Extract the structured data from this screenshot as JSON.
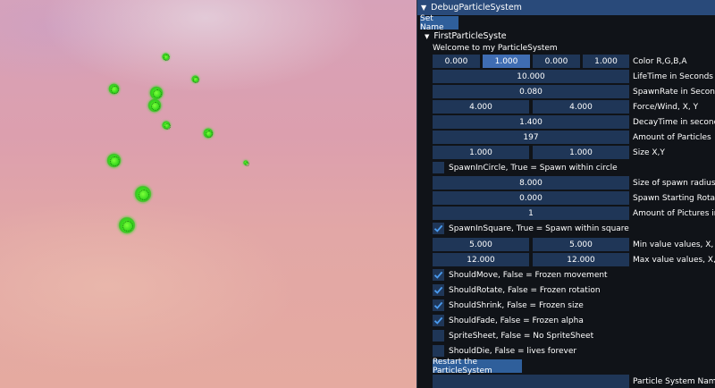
{
  "window": {
    "title": "DebugParticleSystem",
    "set_name_button": "Set Name",
    "tree_node": "FirstParticleSyste",
    "welcome": "Welcome to my ParticleSystem"
  },
  "color": {
    "r": "0.000",
    "g": "1.000",
    "b": "0.000",
    "a": "1.000",
    "label": "Color R,G,B,A"
  },
  "lifetime": {
    "value": "10.000",
    "label": "LifeTime in Seconds"
  },
  "spawnrate": {
    "value": "0.080",
    "label": "SpawnRate in Seconds"
  },
  "force": {
    "x": "4.000",
    "y": "4.000",
    "label": "Force/Wind, X, Y"
  },
  "decay": {
    "value": "1.400",
    "label": "DecayTime in seconds"
  },
  "amount": {
    "value": "197",
    "label": "Amount of Particles"
  },
  "size": {
    "x": "1.000",
    "y": "1.000",
    "label": "Size X,Y"
  },
  "spawn_circle": {
    "label": "SpawnInCircle, True = Spawn within circle",
    "checked": false
  },
  "spawn_radius": {
    "value": "8.000",
    "label": "Size of spawn radius"
  },
  "spawn_rotation": {
    "value": "0.000",
    "label": "Spawn Starting Rotation"
  },
  "pictures": {
    "value": "1",
    "label": "Amount of Pictures in Sp"
  },
  "spawn_square": {
    "label": "SpawnInSquare, True = Spawn within square",
    "checked": true
  },
  "min_values": {
    "x": "5.000",
    "y": "5.000",
    "label": "Min value values, X, Y"
  },
  "max_values": {
    "x": "12.000",
    "y": "12.000",
    "label": "Max value values, X, Y"
  },
  "flags": [
    {
      "label": "ShouldMove, False = Frozen movement",
      "checked": true
    },
    {
      "label": "ShouldRotate, False = Frozen rotation",
      "checked": true
    },
    {
      "label": "ShouldShrink, False = Frozen size",
      "checked": true
    },
    {
      "label": "ShouldFade, False = Frozen alpha",
      "checked": true
    },
    {
      "label": "SpriteSheet, False = No SpriteSheet",
      "checked": false
    },
    {
      "label": "ShouldDie, False = lives forever",
      "checked": false
    }
  ],
  "restart_button": "Restart the ParticleSystem",
  "name_field": {
    "value": "",
    "label": "Particle System Name"
  },
  "colors": {
    "panel_bg": "#101318",
    "title_bg": "#294a7a",
    "field_bg": "#1f3657",
    "button_bg": "#2f5f9b",
    "particle": "#3fe01f"
  }
}
